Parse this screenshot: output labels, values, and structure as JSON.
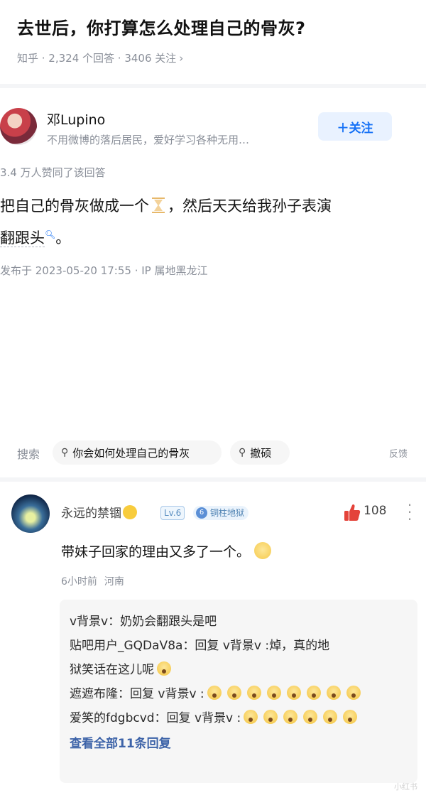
{
  "question": {
    "title": "去世后，你打算怎么处理自己的骨灰?",
    "meta": "知乎 · 2,324 个回答 · 3406 关注",
    "chevron": "›"
  },
  "answer": {
    "author_name": "邓Lupino",
    "author_bio": "不用微博的落后居民，爱好学习各种无用…",
    "follow_label": "＋关注",
    "vote_text": "3.4 万人赞同了该回答",
    "text_before": "把自己的骨灰做成一个",
    "text_after": "，然后天天给我孙子表演",
    "link_word": "翻跟头",
    "link_mark": "🔍︎",
    "text_end": "。",
    "publish_time": "发布于 2023-05-20 17:55 · IP 属地黑龙江"
  },
  "search": {
    "label": "搜索",
    "chips": [
      "你会如何处理自己的骨灰",
      "撤硕"
    ],
    "feedback": "反馈"
  },
  "comment": {
    "user_name": "永远的禁锢",
    "level": "Lv.6",
    "rank_num": "6",
    "rank_name": "铜柱地狱",
    "like_count": "108",
    "text": "带妹子回家的理由又多了一个。",
    "time": "6小时前",
    "location": "河南",
    "replies": [
      {
        "prefix": "v背景v：奶奶会翻跟头是吧"
      },
      {
        "prefix": "贴吧用户_GQDaV8a：回复 v背景v :焯，真的地"
      },
      {
        "prefix": "狱笑话在这儿呢"
      },
      {
        "prefix": "遮遮布隆：回复 v背景v :"
      },
      {
        "prefix": "爱笑的fdgbcvd：回复 v背景v :"
      }
    ],
    "view_all": "查看全部11条回复",
    "watermark": "小红书"
  },
  "icons": [
    "avatar",
    "hourglass-icon",
    "search-icon",
    "thumbs-up-icon",
    "more-icon",
    "smile-emoji",
    "wow-emoji"
  ]
}
